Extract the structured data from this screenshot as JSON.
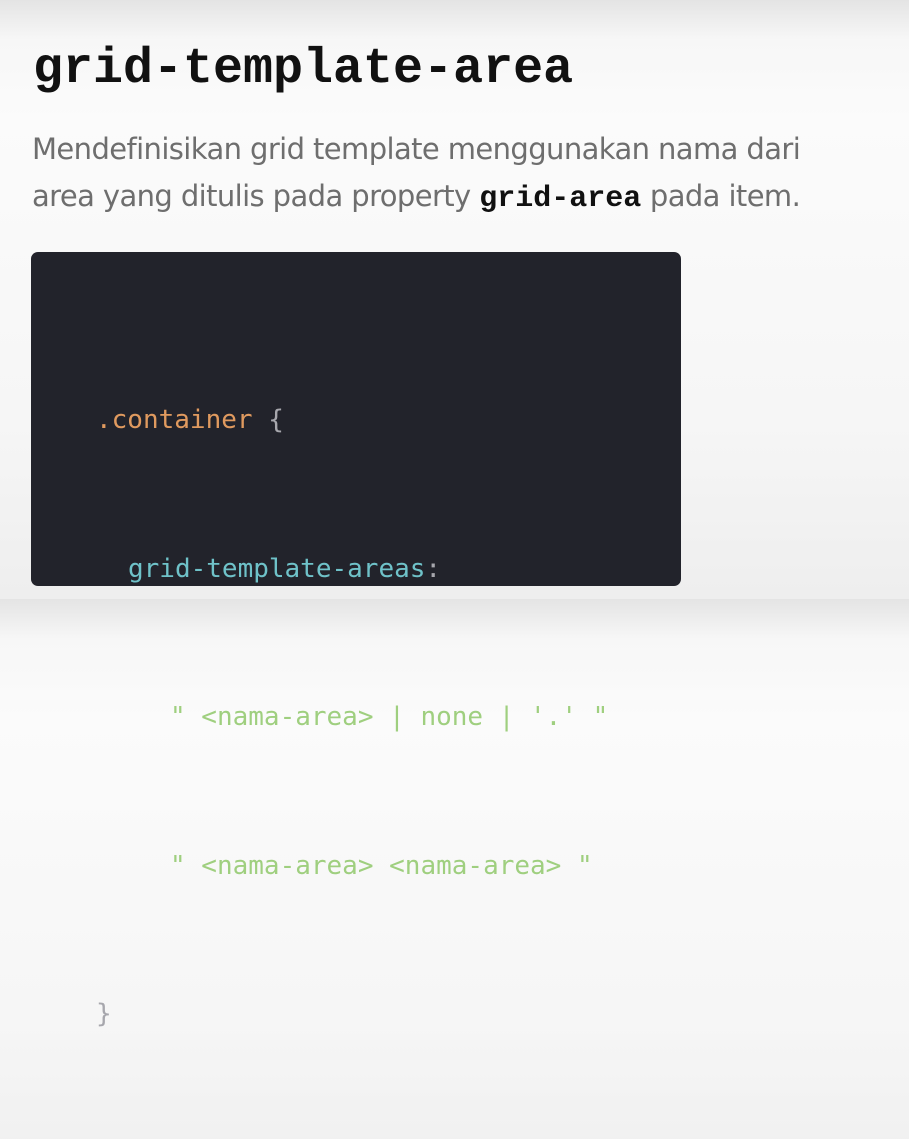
{
  "slide": {
    "title": "grid-template-area",
    "description": {
      "line1": "Mendefinisikan grid template menggunakan nama dari",
      "line2_before": "area yang ditulis pada property ",
      "line2_code": "grid-area",
      "line2_after": " pada item."
    },
    "code": {
      "selector": ".container",
      "open_brace": " {",
      "property": "grid-template-areas",
      "colon": ":",
      "value_line1": "\" <nama-area> | none | '.' \"",
      "value_line2": "\" <nama-area> <nama-area> \"",
      "close_brace": "}"
    },
    "colors": {
      "code_background": "#22232b",
      "selector": "#e09a5f",
      "property": "#6fc2c9",
      "string": "#9fcf7f",
      "punctuation": "#a7a7ad",
      "title_text": "#111111",
      "description_text": "#6e6e6e"
    }
  }
}
